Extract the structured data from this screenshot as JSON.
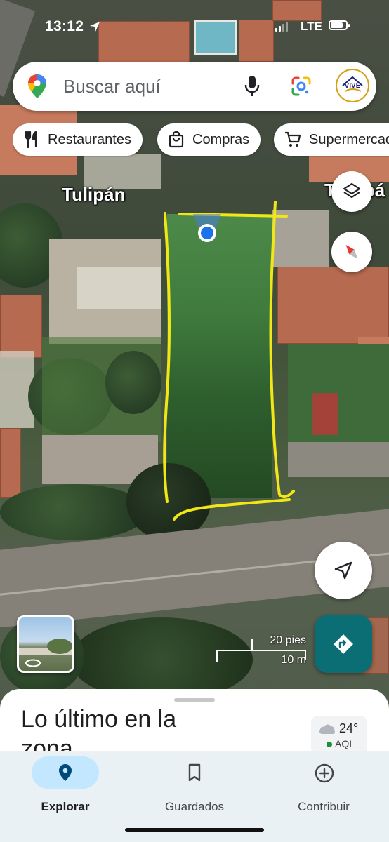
{
  "status_bar": {
    "time": "13:12",
    "network": "LTE"
  },
  "search": {
    "placeholder": "Buscar aquí",
    "avatar_text": "VIVE"
  },
  "chips": [
    {
      "label": "Restaurantes",
      "icon": "fork-knife-icon"
    },
    {
      "label": "Compras",
      "icon": "shopping-bag-icon"
    },
    {
      "label": "Supermercados",
      "icon": "cart-icon"
    }
  ],
  "map": {
    "street_label": "Tulipán",
    "street_label_right": "T",
    "street_label_right_tail": "pá"
  },
  "scale": {
    "imperial": "20 pies",
    "metric": "10 m"
  },
  "sheet": {
    "title": "Lo último en la zona"
  },
  "weather": {
    "temp": "24°",
    "aqi": "AQI"
  },
  "nav": [
    {
      "label": "Explorar",
      "icon": "location-pin-icon",
      "active": true
    },
    {
      "label": "Guardados",
      "icon": "bookmark-icon",
      "active": false
    },
    {
      "label": "Contribuir",
      "icon": "plus-circle-icon",
      "active": false
    }
  ],
  "colors": {
    "accent": "#0b6e75",
    "highlight": "#f1e616",
    "nav_active": "#c2e7ff",
    "location": "#1a73e8"
  }
}
